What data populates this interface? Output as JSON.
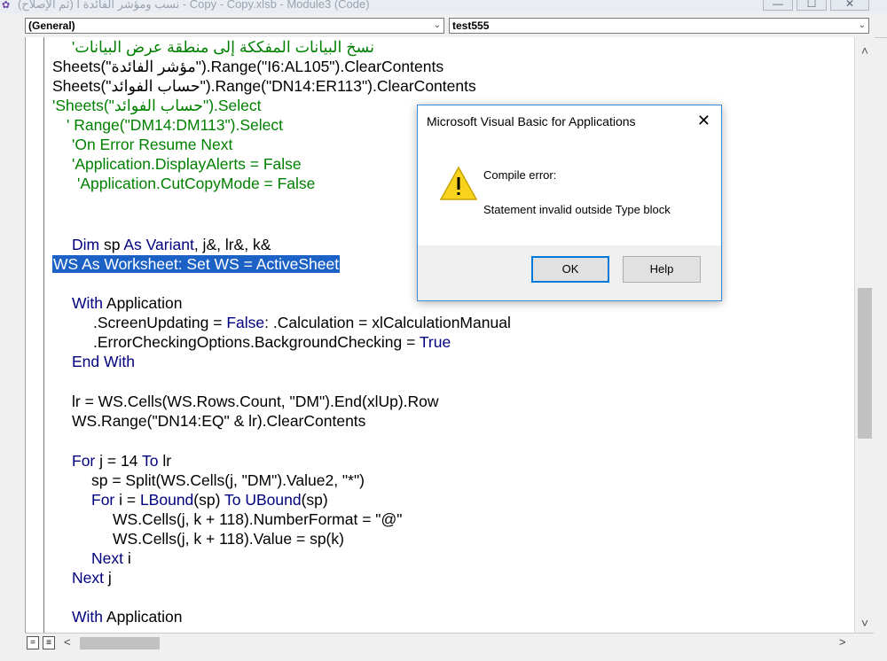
{
  "window": {
    "title": "(ثم الإصلاح) نسب ومؤشر الفائدة ا - Copy - Copy.xlsb - Module3 (Code)",
    "minimize_glyph": "—",
    "maximize_glyph": "☐",
    "close_glyph": "✕"
  },
  "combos": {
    "object": "(General)",
    "procedure": "test555"
  },
  "code_lines": [
    "نسخ البيانات المفككة إلى منطقة عرض البيانات'",
    "Sheets(\"مؤشر الفائدة\").Range(\"I6:AL105\").ClearContents",
    "Sheets(\"حساب الفوائد\").Range(\"DN14:ER113\").ClearContents",
    "'Sheets(\"حساب الفوائد\").Select",
    "' Range(\"DM14:DM113\").Select",
    "'On Error Resume Next",
    "'Application.DisplayAlerts = False",
    "'Application.CutCopyMode = False",
    "Dim sp As Variant, j&, lr&, k&",
    "WS As Worksheet: Set WS = ActiveSheet",
    "With Application",
    ".ScreenUpdating = False: .Calculation = xlCalculationManual",
    ".ErrorCheckingOptions.BackgroundChecking = True",
    "End With",
    "lr = WS.Cells(WS.Rows.Count, \"DM\").End(xlUp).Row",
    "WS.Range(\"DN14:EQ\" & lr).ClearContents",
    "For j = 14 To lr",
    "sp = Split(WS.Cells(j, \"DM\").Value2, \"*\")",
    "For i = LBound(sp) To UBound(sp)",
    "WS.Cells(j, k + 118).NumberFormat = \"@\"",
    "WS.Cells(j, k + 118).Value = sp(k)",
    "Next i",
    "Next j",
    "With Application"
  ],
  "dialog": {
    "title": "Microsoft Visual Basic for Applications",
    "close_glyph": "✕",
    "heading": "Compile error:",
    "message": "Statement invalid outside Type block",
    "ok_label": "OK",
    "help_label": "Help",
    "icon": "warning-icon"
  },
  "scroll": {
    "up_glyph": "˄",
    "down_glyph": "˅",
    "left_glyph": "<",
    "right_glyph": ">"
  },
  "colors": {
    "keyword": "#00007f",
    "comment": "#008000",
    "selection": "#1c62c6"
  }
}
